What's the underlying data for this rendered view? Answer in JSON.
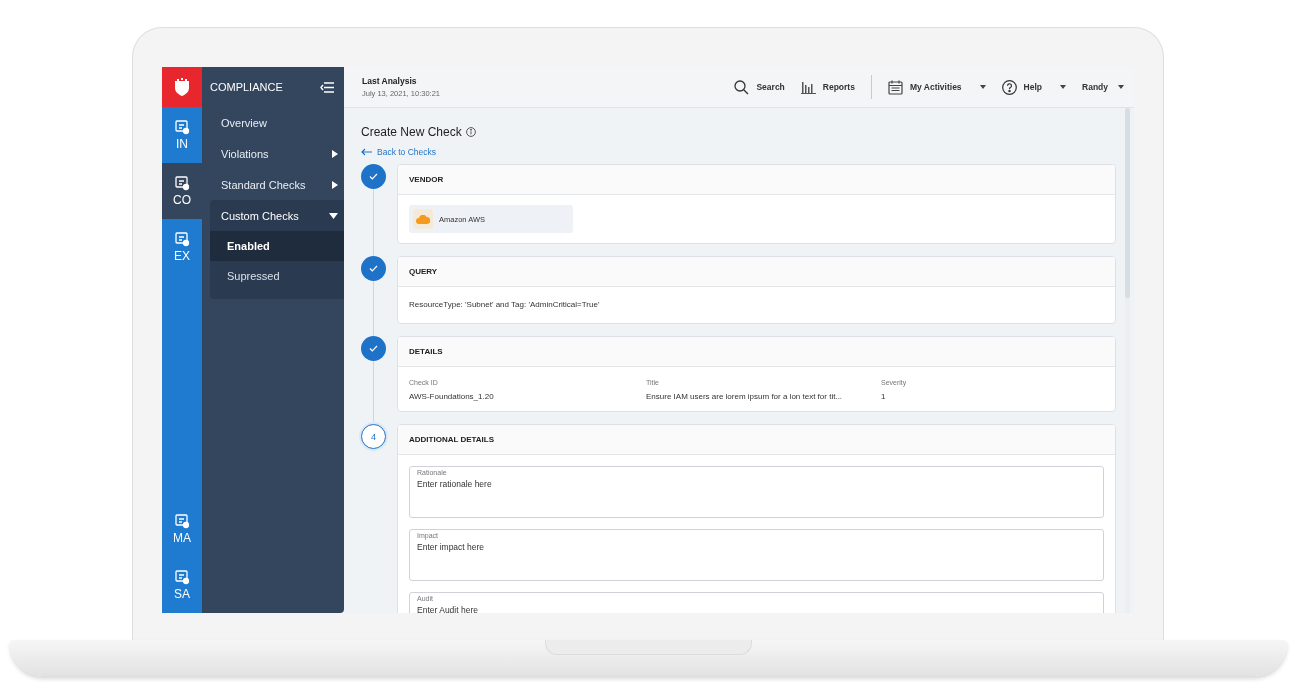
{
  "rail": {
    "top_items": [
      {
        "label": "IN",
        "selected": false
      },
      {
        "label": "CO",
        "selected": true
      },
      {
        "label": "EX",
        "selected": false
      }
    ],
    "bottom_items": [
      {
        "label": "MA",
        "selected": false
      },
      {
        "label": "SA",
        "selected": false
      }
    ]
  },
  "nav": {
    "title": "COMPLIANCE",
    "items": [
      {
        "label": "Overview"
      },
      {
        "label": "Violations",
        "expanded": false
      },
      {
        "label": "Standard Checks",
        "expanded": false
      },
      {
        "label": "Custom Checks",
        "expanded": true,
        "children": [
          {
            "label": "Enabled",
            "selected": true
          },
          {
            "label": "Supressed",
            "selected": false
          }
        ]
      }
    ]
  },
  "top_bar": {
    "analysis_label": "Last Analysis",
    "analysis_time": "July 13, 2021, 10:30:21",
    "search": "Search",
    "reports": "Reports",
    "activities": "My Activities",
    "help": "Help",
    "user": "Randy"
  },
  "page": {
    "title": "Create New Check",
    "back_link": "Back to Checks"
  },
  "steps": [
    {
      "kind": "vendor",
      "completed": true,
      "title": "VENDOR",
      "vendor": "Amazon AWS"
    },
    {
      "kind": "query",
      "completed": true,
      "title": "QUERY",
      "query": "ResourceType: 'Subnet' and Tag: 'AdminCritical=True'"
    },
    {
      "kind": "details",
      "completed": true,
      "title": "DETAILS",
      "fields": [
        {
          "label": "Check ID",
          "value": "AWS-Foundations_1.20"
        },
        {
          "label": "Title",
          "value": "Ensure IAM users are lorem ipsum for a lon text for tit..."
        },
        {
          "label": "Severity",
          "value": "1"
        }
      ]
    },
    {
      "kind": "form",
      "completed": false,
      "number": "4",
      "title": "ADDITIONAL DETAILS",
      "fields": [
        {
          "label": "Rationale",
          "placeholder": "Enter rationale here"
        },
        {
          "label": "Impact",
          "placeholder": "Enter impact here"
        },
        {
          "label": "Audit",
          "placeholder": "Enter Audit here"
        }
      ]
    }
  ]
}
